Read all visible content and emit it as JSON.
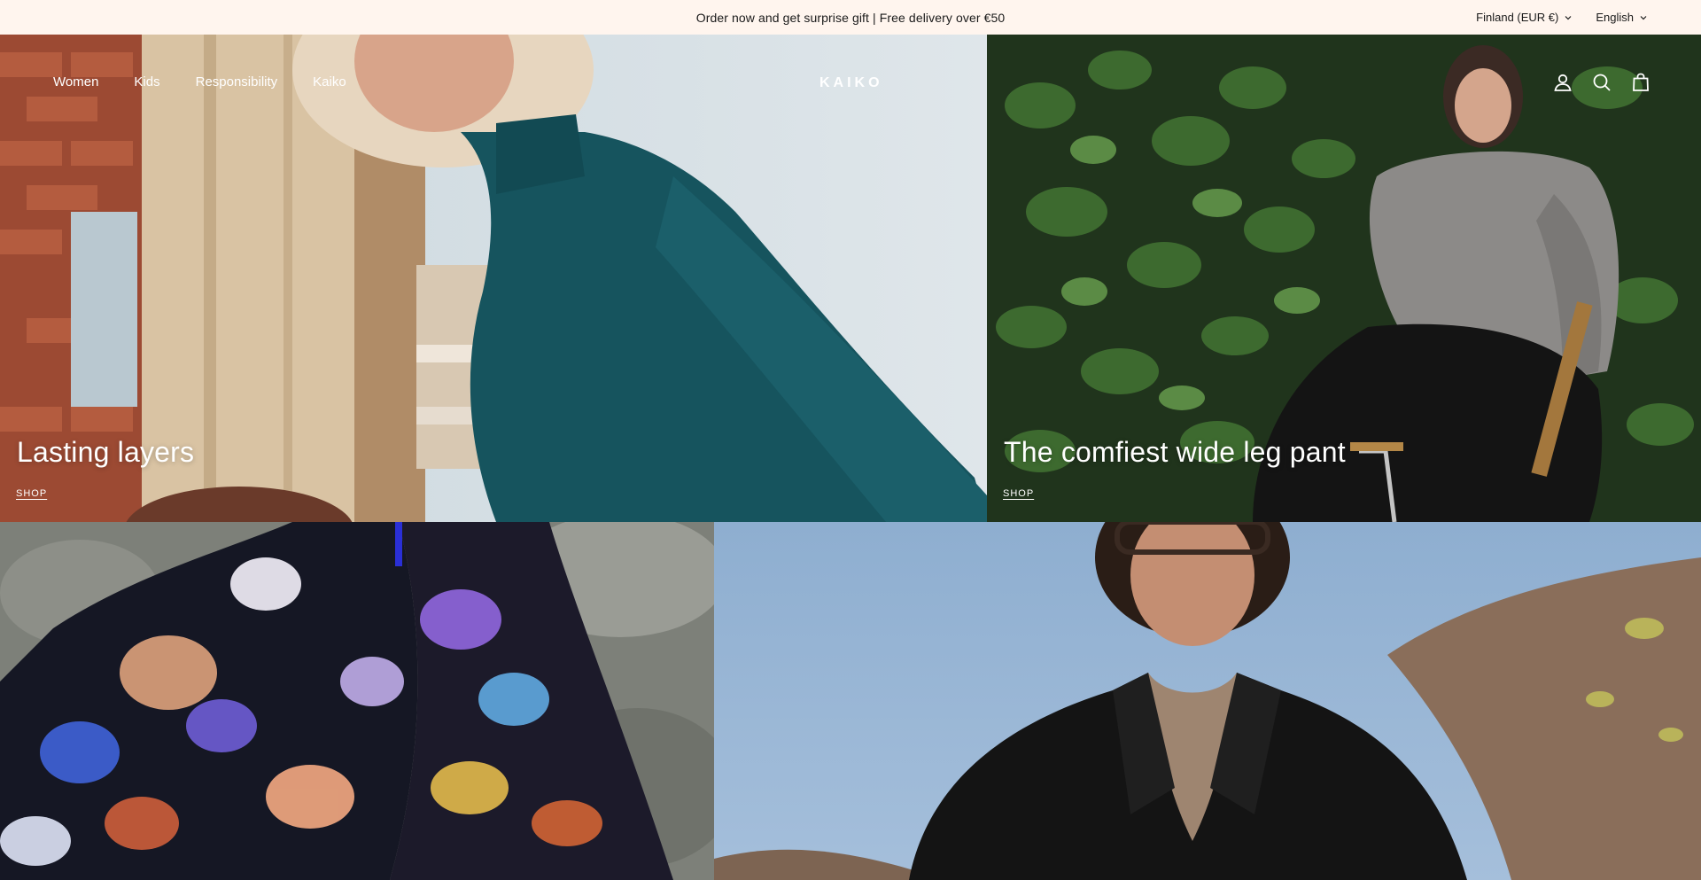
{
  "announcement": {
    "message": "Order now and get surprise gift | Free delivery over €50",
    "country_label": "Finland (EUR €)",
    "language_label": "English"
  },
  "header": {
    "logo_text": "KAIKO",
    "nav": [
      {
        "label": "Women"
      },
      {
        "label": "Kids"
      },
      {
        "label": "Responsibility"
      },
      {
        "label": "Kaiko"
      }
    ],
    "icons": [
      "account-icon",
      "search-icon",
      "cart-icon"
    ]
  },
  "hero": {
    "tiles": [
      {
        "title": "Lasting layers",
        "cta": "SHOP"
      },
      {
        "title": "The comfiest wide leg pant",
        "cta": "SHOP"
      },
      {
        "title": "",
        "cta": ""
      },
      {
        "title": "",
        "cta": ""
      }
    ]
  },
  "colors": {
    "announcement_bg": "#fff5ee",
    "text_dark": "#1a1a1a",
    "overlay_text": "#ffffff"
  }
}
